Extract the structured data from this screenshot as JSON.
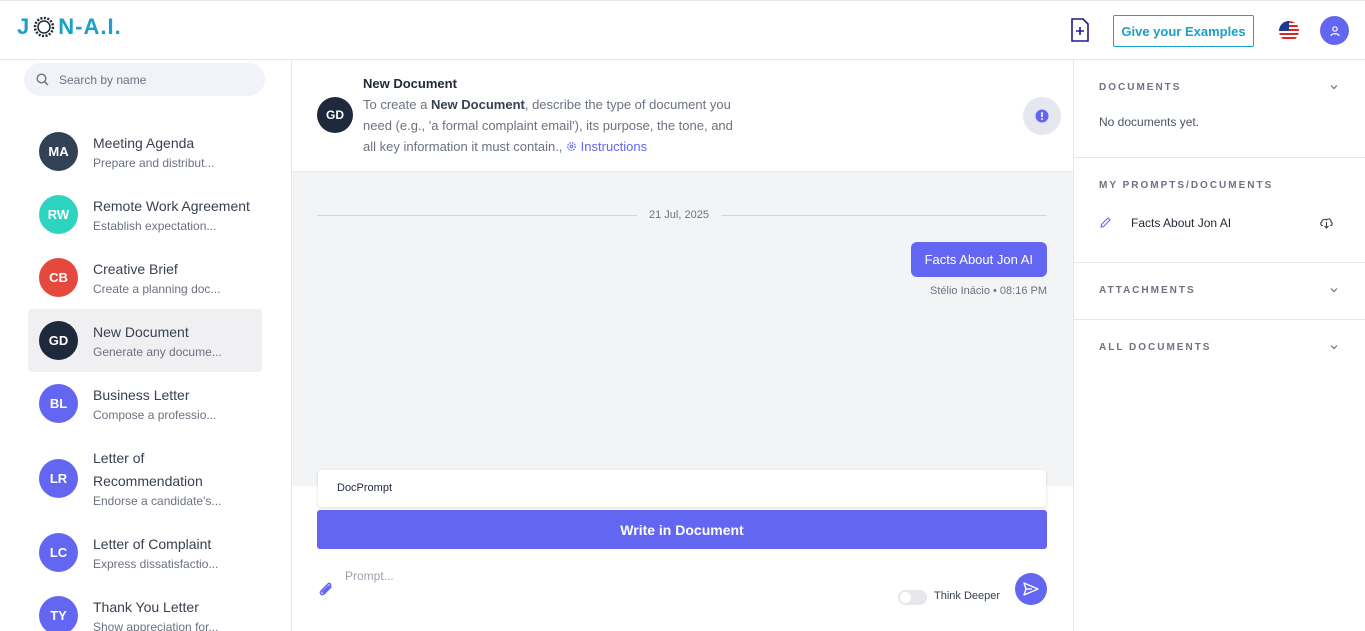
{
  "header": {
    "logo": {
      "left": "J",
      "right": "N-A.I."
    },
    "new_doc_icon": "file-plus-icon",
    "give_examples_label": "Give your Examples",
    "flag_icon": "us-flag-icon",
    "user_icon": "user-icon"
  },
  "sidebar": {
    "search_placeholder": "Search by name",
    "items": [
      {
        "initials": "MA",
        "title": "Meeting Agenda",
        "subtitle": "Prepare and distribut...",
        "color": "#334155"
      },
      {
        "initials": "RW",
        "title": "Remote Work Agreement",
        "subtitle": "Establish expectation...",
        "color": "#2dd4bf"
      },
      {
        "initials": "CB",
        "title": "Creative Brief",
        "subtitle": "Create a planning doc...",
        "color": "#ef4444"
      },
      {
        "initials": "GD",
        "title": "New Document",
        "subtitle": "Generate any docume...",
        "color": "#1e293b"
      },
      {
        "initials": "BL",
        "title": "Business Letter",
        "subtitle": "Compose a professio...",
        "color": "#6366f1"
      },
      {
        "initials": "LR",
        "title": "Letter of Recommendation",
        "subtitle": "Endorse a candidate's...",
        "color": "#6366f1"
      },
      {
        "initials": "LC",
        "title": "Letter of Complaint",
        "subtitle": "Express dissatisfactio...",
        "color": "#6366f1"
      },
      {
        "initials": "TY",
        "title": "Thank You Letter",
        "subtitle": "Show appreciation for...",
        "color": "#6366f1"
      }
    ]
  },
  "main": {
    "avatar": "GD",
    "title": "New Document",
    "desc_prefix": "To create a ",
    "desc_bold": "New Document",
    "desc_rest": ", describe the type of document you need (e.g., 'a formal complaint email'), its purpose, the tone, and all key information it must contain.,",
    "instructions_label": "Instructions",
    "date": "21 Jul, 2025",
    "message": "Facts About Jon AI",
    "message_meta": "Stélio Inácio • 08:16 PM",
    "docprompt_label": "DocPrompt",
    "write_button": "Write in Document",
    "prompt_placeholder": "Prompt...",
    "think_deeper_label": "Think Deeper"
  },
  "right_panel": {
    "documents_title": "DOCUMENTS",
    "documents_empty": "No documents yet.",
    "my_prompts_title": "MY PROMPTS/DOCUMENTS",
    "prompt_item": "Facts About Jon AI",
    "attachments_title": "ATTACHMENTS",
    "all_documents_title": "ALL DOCUMENTS"
  },
  "colors": {
    "brand": "#1aa0c9",
    "accent": "#6366f1"
  }
}
